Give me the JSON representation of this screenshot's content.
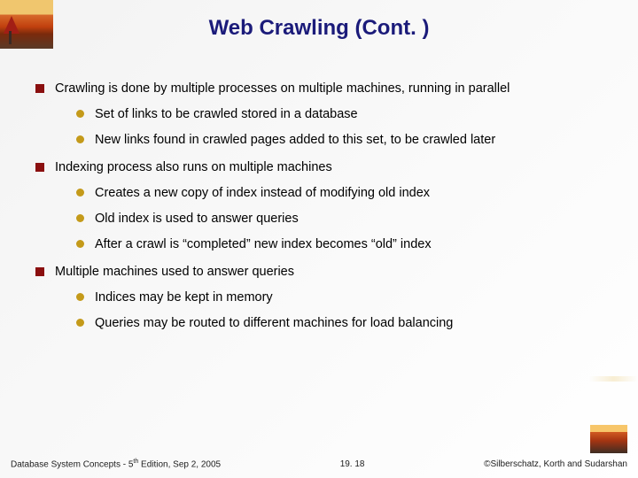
{
  "title": "Web Crawling (Cont. )",
  "bullets": {
    "b1": "Crawling is done by multiple processes on multiple machines, running in parallel",
    "b1_1": "Set of links to be crawled stored in a database",
    "b1_2": "New links found in crawled pages added to this set, to be crawled later",
    "b2": "Indexing process also runs on multiple machines",
    "b2_1": "Creates a new copy of index instead of modifying old index",
    "b2_2": "Old index is used to answer queries",
    "b2_3": "After a crawl is “completed” new index becomes “old” index",
    "b3": "Multiple machines used to answer queries",
    "b3_1": "Indices may be kept in memory",
    "b3_2": "Queries may be routed to different machines for load balancing"
  },
  "footer": {
    "left_a": "Database System Concepts - 5",
    "left_sup": "th",
    "left_b": " Edition, Sep 2, 2005",
    "center": "19. 18",
    "right": "©Silberschatz, Korth and Sudarshan"
  }
}
